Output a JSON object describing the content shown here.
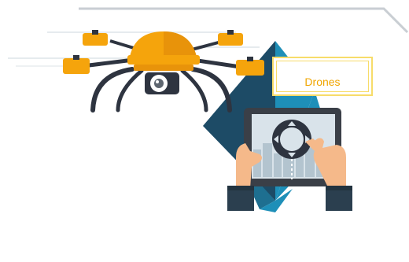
{
  "label": {
    "text": "Drones"
  },
  "colors": {
    "drone_body": "#f5a40c",
    "drone_dark": "#2e3440",
    "diamond_navy": "#1d4b66",
    "diamond_teal": "#1e8fb8",
    "tablet_frame": "#3a3f47",
    "screen_bg": "#d9e3ea",
    "skin": "#f5b98a",
    "sleeve": "#2b3f4f",
    "label_border": "#f7dc6a",
    "label_text": "#f0a500"
  },
  "icons": [
    "drone-illustration",
    "tablet-illustration",
    "joystick-icon",
    "hands-illustration"
  ]
}
